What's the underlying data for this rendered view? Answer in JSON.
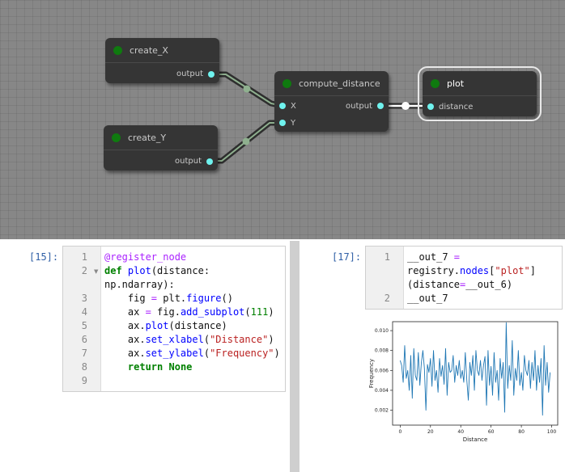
{
  "graph": {
    "nodes": {
      "create_x": {
        "title": "create_X",
        "output": "output"
      },
      "create_y": {
        "title": "create_Y",
        "output": "output"
      },
      "compute_distance": {
        "title": "compute_distance",
        "input_x": "X",
        "input_y": "Y",
        "output": "output"
      },
      "plot": {
        "title": "plot",
        "input": "distance"
      }
    },
    "colors": {
      "canvas": "#878787",
      "node": "#353535",
      "port": "#6ff2ee",
      "status_dot": "#0f7a0f"
    }
  },
  "notebook": {
    "cell_15": {
      "prompt": "[15]:",
      "line_numbers": [
        "1",
        "2",
        "3",
        "4",
        "5",
        "6",
        "7",
        "8",
        "9"
      ]
    },
    "cell_17": {
      "prompt": "[17]:",
      "line_numbers": [
        "1",
        "2"
      ]
    }
  },
  "chart_data": {
    "type": "line",
    "xlabel": "Distance",
    "ylabel": "Frequency",
    "xlim": [
      -5,
      104
    ],
    "ylim": [
      0.0005,
      0.0109
    ],
    "xticks": [
      0,
      20,
      40,
      60,
      80,
      100
    ],
    "yticks": [
      "0.002",
      "0.004",
      "0.006",
      "0.008",
      "0.010"
    ],
    "series": [
      {
        "color": "#1f77b4",
        "x": [
          0,
          1,
          2,
          3,
          4,
          5,
          6,
          7,
          8,
          9,
          10,
          11,
          12,
          13,
          14,
          15,
          16,
          17,
          18,
          19,
          20,
          21,
          22,
          23,
          24,
          25,
          26,
          27,
          28,
          29,
          30,
          31,
          32,
          33,
          34,
          35,
          36,
          37,
          38,
          39,
          40,
          41,
          42,
          43,
          44,
          45,
          46,
          47,
          48,
          49,
          50,
          51,
          52,
          53,
          54,
          55,
          56,
          57,
          58,
          59,
          60,
          61,
          62,
          63,
          64,
          65,
          66,
          67,
          68,
          69,
          70,
          71,
          72,
          73,
          74,
          75,
          76,
          77,
          78,
          79,
          80,
          81,
          82,
          83,
          84,
          85,
          86,
          87,
          88,
          89,
          90,
          91,
          92,
          93,
          94,
          95,
          96,
          97,
          98,
          99
        ],
        "values": [
          0.007,
          0.0065,
          0.0048,
          0.0085,
          0.0052,
          0.006,
          0.004,
          0.0075,
          0.0032,
          0.0082,
          0.0055,
          0.005,
          0.0078,
          0.0045,
          0.0068,
          0.008,
          0.0062,
          0.002,
          0.0066,
          0.0058,
          0.0072,
          0.0044,
          0.008,
          0.005,
          0.006,
          0.0038,
          0.0072,
          0.0054,
          0.0065,
          0.0046,
          0.0082,
          0.0035,
          0.0068,
          0.0058,
          0.006,
          0.0075,
          0.0048,
          0.0065,
          0.0055,
          0.007,
          0.0052,
          0.006,
          0.0048,
          0.0078,
          0.005,
          0.003,
          0.0068,
          0.0055,
          0.0075,
          0.004,
          0.008,
          0.006,
          0.0055,
          0.007,
          0.005,
          0.0065,
          0.0074,
          0.0025,
          0.008,
          0.0045,
          0.0064,
          0.0035,
          0.0078,
          0.0048,
          0.006,
          0.003,
          0.0072,
          0.0052,
          0.0068,
          0.0018,
          0.0108,
          0.0042,
          0.0065,
          0.005,
          0.009,
          0.0035,
          0.0062,
          0.005,
          0.008,
          0.0045,
          0.0058,
          0.004,
          0.0075,
          0.006,
          0.0055,
          0.007,
          0.0042,
          0.0068,
          0.005,
          0.008,
          0.004,
          0.0065,
          0.0048,
          0.0072,
          0.0015,
          0.0085,
          0.0045,
          0.0068,
          0.0038,
          0.0058
        ]
      }
    ]
  }
}
